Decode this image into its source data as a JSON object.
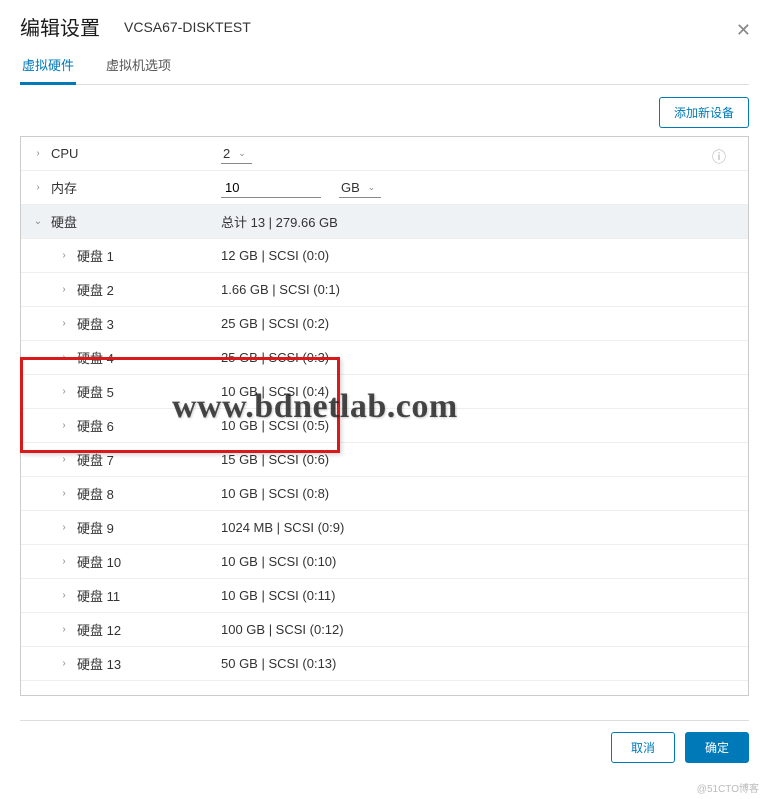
{
  "dialog": {
    "title": "编辑设置",
    "subtitle": "VCSA67-DISKTEST"
  },
  "tabs": {
    "hardware": "虚拟硬件",
    "options": "虚拟机选项"
  },
  "toolbar": {
    "add_device": "添加新设备"
  },
  "rows": {
    "cpu_label": "CPU",
    "cpu_value": "2",
    "mem_label": "内存",
    "mem_value": "10",
    "mem_unit": "GB",
    "disks_label": "硬盘",
    "disks_summary": "总计 13 | 279.66 GB"
  },
  "disks": [
    {
      "label": "硬盘 1",
      "value": "12 GB | SCSI (0:0)"
    },
    {
      "label": "硬盘 2",
      "value": "1.66 GB | SCSI (0:1)"
    },
    {
      "label": "硬盘 3",
      "value": "25 GB | SCSI (0:2)"
    },
    {
      "label": "硬盘 4",
      "value": "25 GB | SCSI (0:3)"
    },
    {
      "label": "硬盘 5",
      "value": "10 GB | SCSI (0:4)"
    },
    {
      "label": "硬盘 6",
      "value": "10 GB | SCSI (0:5)"
    },
    {
      "label": "硬盘 7",
      "value": "15 GB | SCSI (0:6)"
    },
    {
      "label": "硬盘 8",
      "value": "10 GB | SCSI (0:8)"
    },
    {
      "label": "硬盘 9",
      "value": "1024 MB | SCSI (0:9)"
    },
    {
      "label": "硬盘 10",
      "value": "10 GB | SCSI (0:10)"
    },
    {
      "label": "硬盘 11",
      "value": "10 GB | SCSI (0:11)"
    },
    {
      "label": "硬盘 12",
      "value": "100 GB | SCSI (0:12)"
    },
    {
      "label": "硬盘 13",
      "value": "50 GB | SCSI (0:13)"
    }
  ],
  "footer": {
    "cancel": "取消",
    "ok": "确定"
  },
  "watermark": "www.bdnetlab.com",
  "credit": "@51CTO博客"
}
